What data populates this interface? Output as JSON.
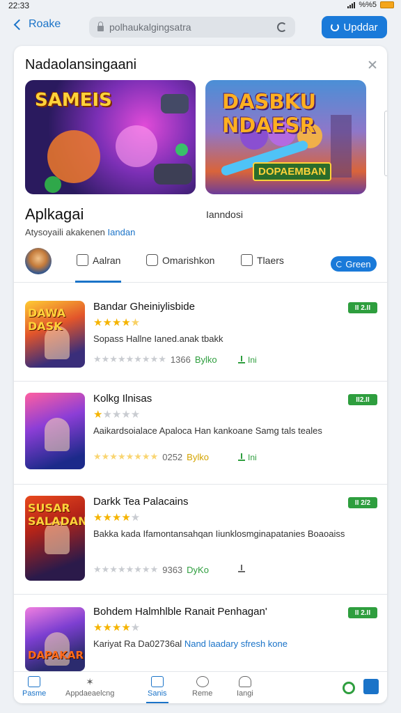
{
  "status_bar": {
    "time": "22:33",
    "network": "%%5"
  },
  "top_bar": {
    "back_label": "Roake",
    "url": "polhaukalgingsatra",
    "update_label": "Upddar"
  },
  "featured": {
    "title": "Nadaolansingaani",
    "banners": [
      {
        "title": "SAMEIS",
        "subtitle": ""
      },
      {
        "title": "DASBKU NDAESR",
        "subtitle": "DOPAEMBAN"
      }
    ]
  },
  "app": {
    "name": "Aplkagai",
    "category": "Ianndosi",
    "description": "Atysoyaili akakenen",
    "description_link": "Iandan"
  },
  "actions": {
    "items": [
      {
        "label": "Aalran",
        "icon": "thumbs-up-icon"
      },
      {
        "label": "Omarishkon",
        "icon": "comment-icon"
      },
      {
        "label": "Tlaers",
        "icon": "thumbs-up-icon"
      }
    ],
    "green_button": "Green"
  },
  "list": [
    {
      "title": "Bandar Gheiniylisbide",
      "rating": 4.5,
      "stars": "★★★★★",
      "description": "Sopass Hallne Ianed.anak tbakk",
      "description_link": "",
      "meta_count": "1366",
      "meta_rating": "Bylko",
      "downloads": "Ini",
      "badge": "II 2.II",
      "thumb_label": "DAWA DASK"
    },
    {
      "title": "Kolkg Ilnisas",
      "rating": 1,
      "stars": "★★★★★",
      "description": "Aaikardsoialace Apaloca Han kankoane Samg tals teales",
      "description_link": "",
      "meta_count": "0252",
      "meta_rating": "Bylko",
      "downloads": "Ini",
      "badge": "II2.II",
      "thumb_label": ""
    },
    {
      "title": "Darkk Tea Palacains",
      "rating": 4,
      "stars": "★★★★★",
      "description": "Bakka kada Ifamontansahqan Iiunklosmginapatanies Boaoaiss",
      "description_link": "",
      "meta_count": "9363",
      "meta_rating": "DyKo",
      "downloads": "",
      "badge": "II 2/2",
      "thumb_label": "SUSAR SALADAN"
    },
    {
      "title": "Bohdem Halmhlble Ranait Penhagan'",
      "rating": 4,
      "stars": "★★★★★",
      "description": "Kariyat Ra Da02736al",
      "description_link": "Nand laadary sfresh kone",
      "meta_count": "",
      "meta_rating": "",
      "downloads": "",
      "badge": "II 2.II",
      "thumb_label": "DAPAKAR"
    }
  ],
  "bottom_nav": [
    {
      "label": "Pasme",
      "icon": "home-icon",
      "active": true
    },
    {
      "label": "Appdaeaelcng",
      "icon": "apps-icon",
      "active": false
    },
    {
      "label": "Sanis",
      "icon": "list-icon",
      "active": true
    },
    {
      "label": "Reme",
      "icon": "gamepad-icon",
      "active": false
    },
    {
      "label": "Iangi",
      "icon": "trophy-icon",
      "active": false
    }
  ],
  "colors": {
    "accent": "#1a7ad9",
    "green": "#2e9e3e",
    "star": "#f5b400"
  }
}
